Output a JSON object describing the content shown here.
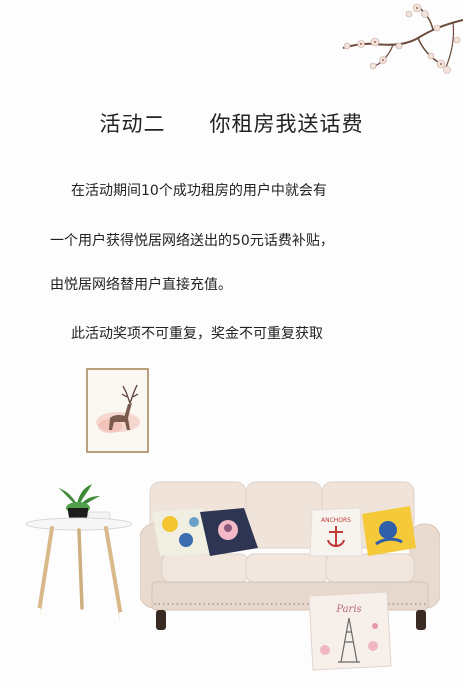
{
  "heading": {
    "part1": "活动二",
    "part2": "你租房我送话费"
  },
  "paragraphs": [
    "在活动期间10个成功租房的用户中就会有",
    "一个用户获得悦居网络送出的50元话费补贴，",
    "由悦居网络替用户直接充值。",
    "此活动奖项不可重复，奖金不可重复获取"
  ],
  "pillow_texts": {
    "anchor": "ANCHORS",
    "paris": "Paris"
  },
  "colors": {
    "background": "#fdfdfd",
    "text": "#222222",
    "sofa": "#ecdfd6",
    "frame": "#b9a07a"
  }
}
